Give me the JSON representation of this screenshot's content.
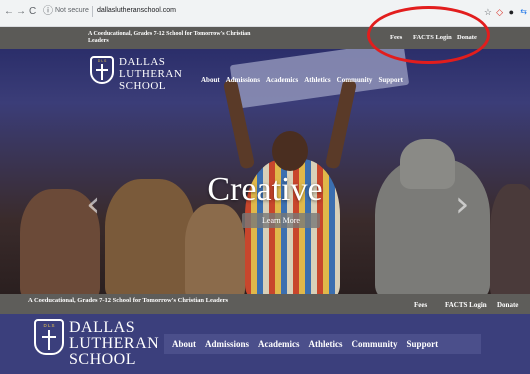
{
  "browser": {
    "back_icon": "←",
    "forward_icon": "→",
    "reload_icon": "C",
    "info_icon": "ⓘ",
    "security_text": "Not secure",
    "url": "dallaslutheranschool.com",
    "bookmark_icon": "☆",
    "ext_icons": [
      "◇",
      "●",
      "⇆"
    ]
  },
  "top_bar": {
    "tagline": "A Coeducational, Grades 7-12 School for Tomorrow's Christian Leaders",
    "links": {
      "fees": "Fees",
      "facts_login": "FACTS Login",
      "donate": "Donate"
    }
  },
  "school": {
    "crest_text": "D L S",
    "name_lines": [
      "DALLAS",
      "LUTHERAN",
      "SCHOOL"
    ]
  },
  "nav": [
    "About",
    "Admissions",
    "Academics",
    "Athletics",
    "Community",
    "Support"
  ],
  "hero": {
    "headline": "Creative",
    "cta": "Learn More",
    "prev_icon": "‹",
    "next_icon": "›"
  },
  "sticky_bar": {
    "tagline": "A Coeducational, Grades 7-12 School for Tomorrow's Christian Leaders",
    "links": {
      "fees": "Fees",
      "facts_login": "FACTS Login",
      "donate": "Donate"
    }
  },
  "colors": {
    "header_navy": "#3b3f7c",
    "utility_gray": "#5b5a57",
    "annotation_red": "#e21d1d"
  }
}
